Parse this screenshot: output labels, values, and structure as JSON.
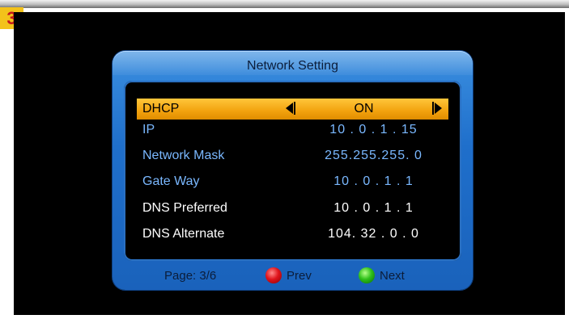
{
  "step_number": "3",
  "window": {
    "title": "Network Setting"
  },
  "settings": [
    {
      "label": "DHCP",
      "value": "ON",
      "selected": true
    },
    {
      "label": "IP",
      "value": "10 . 0 . 1 . 15"
    },
    {
      "label": "Network Mask",
      "value": "255.255.255. 0"
    },
    {
      "label": "Gate Way",
      "value": "10 . 0 . 1 . 1"
    },
    {
      "label": "DNS Preferred",
      "value": "10 . 0 . 1 . 1"
    },
    {
      "label": "DNS Alternate",
      "value": "104. 32 . 0 . 0"
    }
  ],
  "footer": {
    "page": "Page: 3/6",
    "prev": "Prev",
    "next": "Next"
  },
  "colors": {
    "selected_row": "#f2a20e",
    "label_blue": "#7ab8ff",
    "panel_blue": "#1f6fcb",
    "badge_yellow": "#f3c21a",
    "badge_text_red": "#c4161c"
  },
  "icons": {
    "prev_key": "red-button-icon",
    "next_key": "green-button-icon",
    "left_arrow": "arrow-left-icon",
    "right_arrow": "arrow-right-icon"
  }
}
